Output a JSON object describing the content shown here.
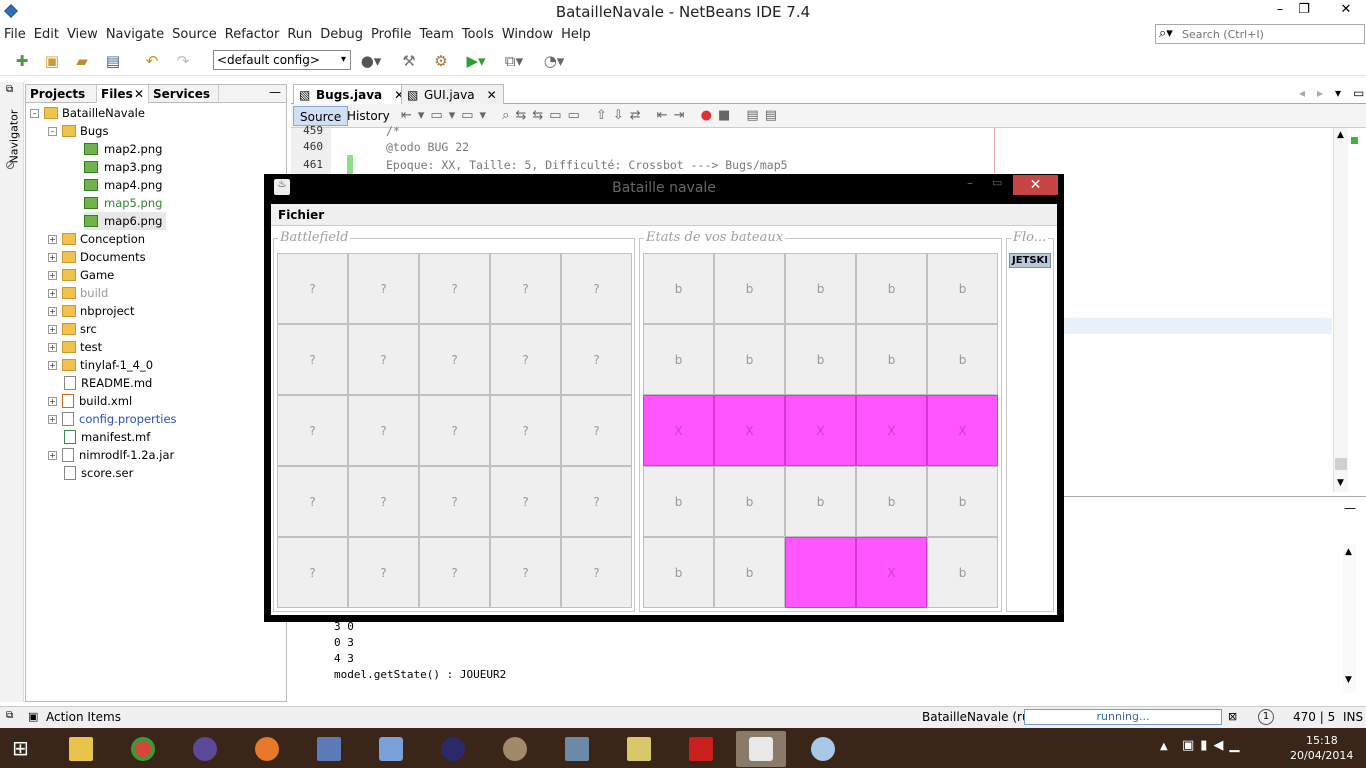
{
  "window": {
    "title": "BatailleNavale - NetBeans IDE 7.4"
  },
  "menu": [
    "File",
    "Edit",
    "View",
    "Navigate",
    "Source",
    "Refactor",
    "Run",
    "Debug",
    "Profile",
    "Team",
    "Tools",
    "Window",
    "Help"
  ],
  "search": {
    "placeholder": "Search (Ctrl+I)"
  },
  "toolbar": {
    "config": "<default config>"
  },
  "left_strip": {
    "navigator": "Navigator"
  },
  "project_panel": {
    "tabs": [
      "Projects",
      "Files",
      "Services"
    ],
    "root": "BatailleNavale",
    "bugs_folder": "Bugs",
    "bugs_files": [
      "map2.png",
      "map3.png",
      "map4.png",
      "map5.png",
      "map6.png"
    ],
    "items": [
      "Conception",
      "Documents",
      "Game",
      "build",
      "nbproject",
      "src",
      "test",
      "tinylaf-1_4_0",
      "README.md",
      "build.xml",
      "config.properties",
      "manifest.mf",
      "nimrodlf-1.2a.jar",
      "score.ser"
    ]
  },
  "editor": {
    "tabs": [
      "Bugs.java",
      "GUI.java"
    ],
    "modes": [
      "Source",
      "History"
    ],
    "line_numbers": [
      "459",
      "460",
      "461"
    ],
    "code_lines": [
      "/*",
      "@todo BUG 22",
      "Epoque: XX, Taille: 5, Difficulté: Crossbot ---> Bugs/map5"
    ]
  },
  "output": {
    "lines": [
      "3 0",
      "0 3",
      "4 3",
      "model.getState() : JOUEUR2"
    ]
  },
  "statusbar": {
    "action_items": "Action Items",
    "run_label": "BatailleNavale (run)",
    "progress": "running...",
    "notifications": "1",
    "position": "470 | 5",
    "mode": "INS"
  },
  "taskbar": {
    "time": "15:18",
    "date": "20/04/2014"
  },
  "dialog": {
    "title": "Bataille navale",
    "menu": "Fichier",
    "battlefield": {
      "legend": "Battlefield",
      "cells": [
        "?",
        "?",
        "?",
        "?",
        "?",
        "?",
        "?",
        "?",
        "?",
        "?",
        "?",
        "?",
        "?",
        "?",
        "?",
        "?",
        "?",
        "?",
        "?",
        "?",
        "?",
        "?",
        "?",
        "?",
        "?"
      ]
    },
    "states": {
      "legend": "Etats de vos bateaux",
      "cells": [
        "b",
        "b",
        "b",
        "b",
        "b",
        "b",
        "b",
        "b",
        "b",
        "b",
        "X",
        "X",
        "X",
        "X",
        "X",
        "b",
        "b",
        "b",
        "b",
        "b",
        "b",
        "b",
        "",
        "X",
        "b"
      ],
      "hit": [
        false,
        false,
        false,
        false,
        false,
        false,
        false,
        false,
        false,
        false,
        true,
        true,
        true,
        true,
        true,
        false,
        false,
        false,
        false,
        false,
        false,
        false,
        true,
        true,
        false
      ]
    },
    "fleet": {
      "legend": "Flo...",
      "items": [
        "JETSKI"
      ]
    }
  },
  "colors": {
    "hit": "#ff55ff",
    "close_button": "#c74545",
    "taskbar": "#3a2618"
  }
}
